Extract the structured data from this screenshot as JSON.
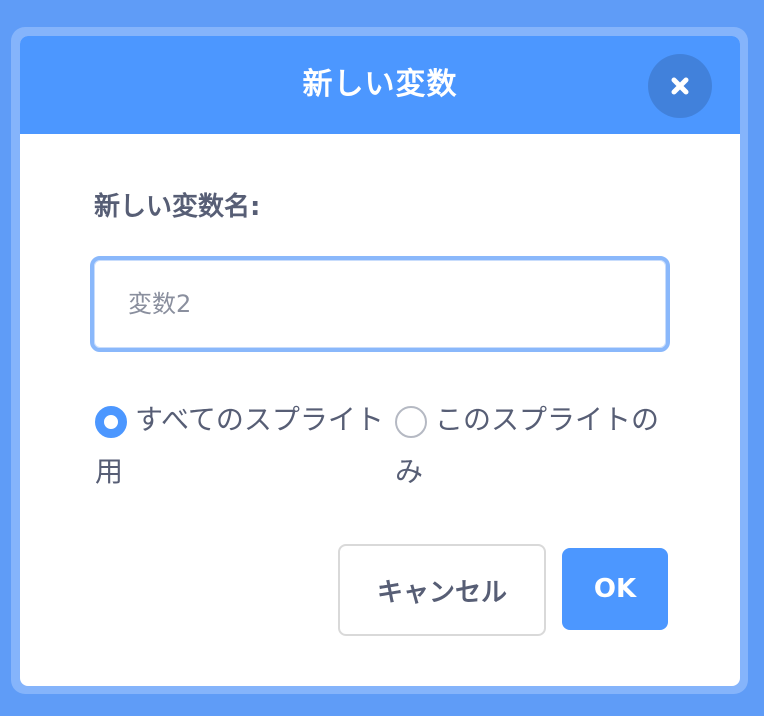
{
  "dialog": {
    "title": "新しい変数",
    "close_icon": "close-icon"
  },
  "name_field": {
    "label": "新しい変数名:",
    "placeholder": "変数2",
    "value": ""
  },
  "scope_options": [
    {
      "label": "すべてのスプライト用",
      "selected": true
    },
    {
      "label": "このスプライトのみ",
      "selected": false
    }
  ],
  "buttons": {
    "cancel_label": "キャンセル",
    "ok_label": "OK"
  },
  "colors": {
    "background": "#5f9cf7",
    "header": "#4c97ff",
    "accent": "#4c97ff",
    "text": "#575e75"
  }
}
